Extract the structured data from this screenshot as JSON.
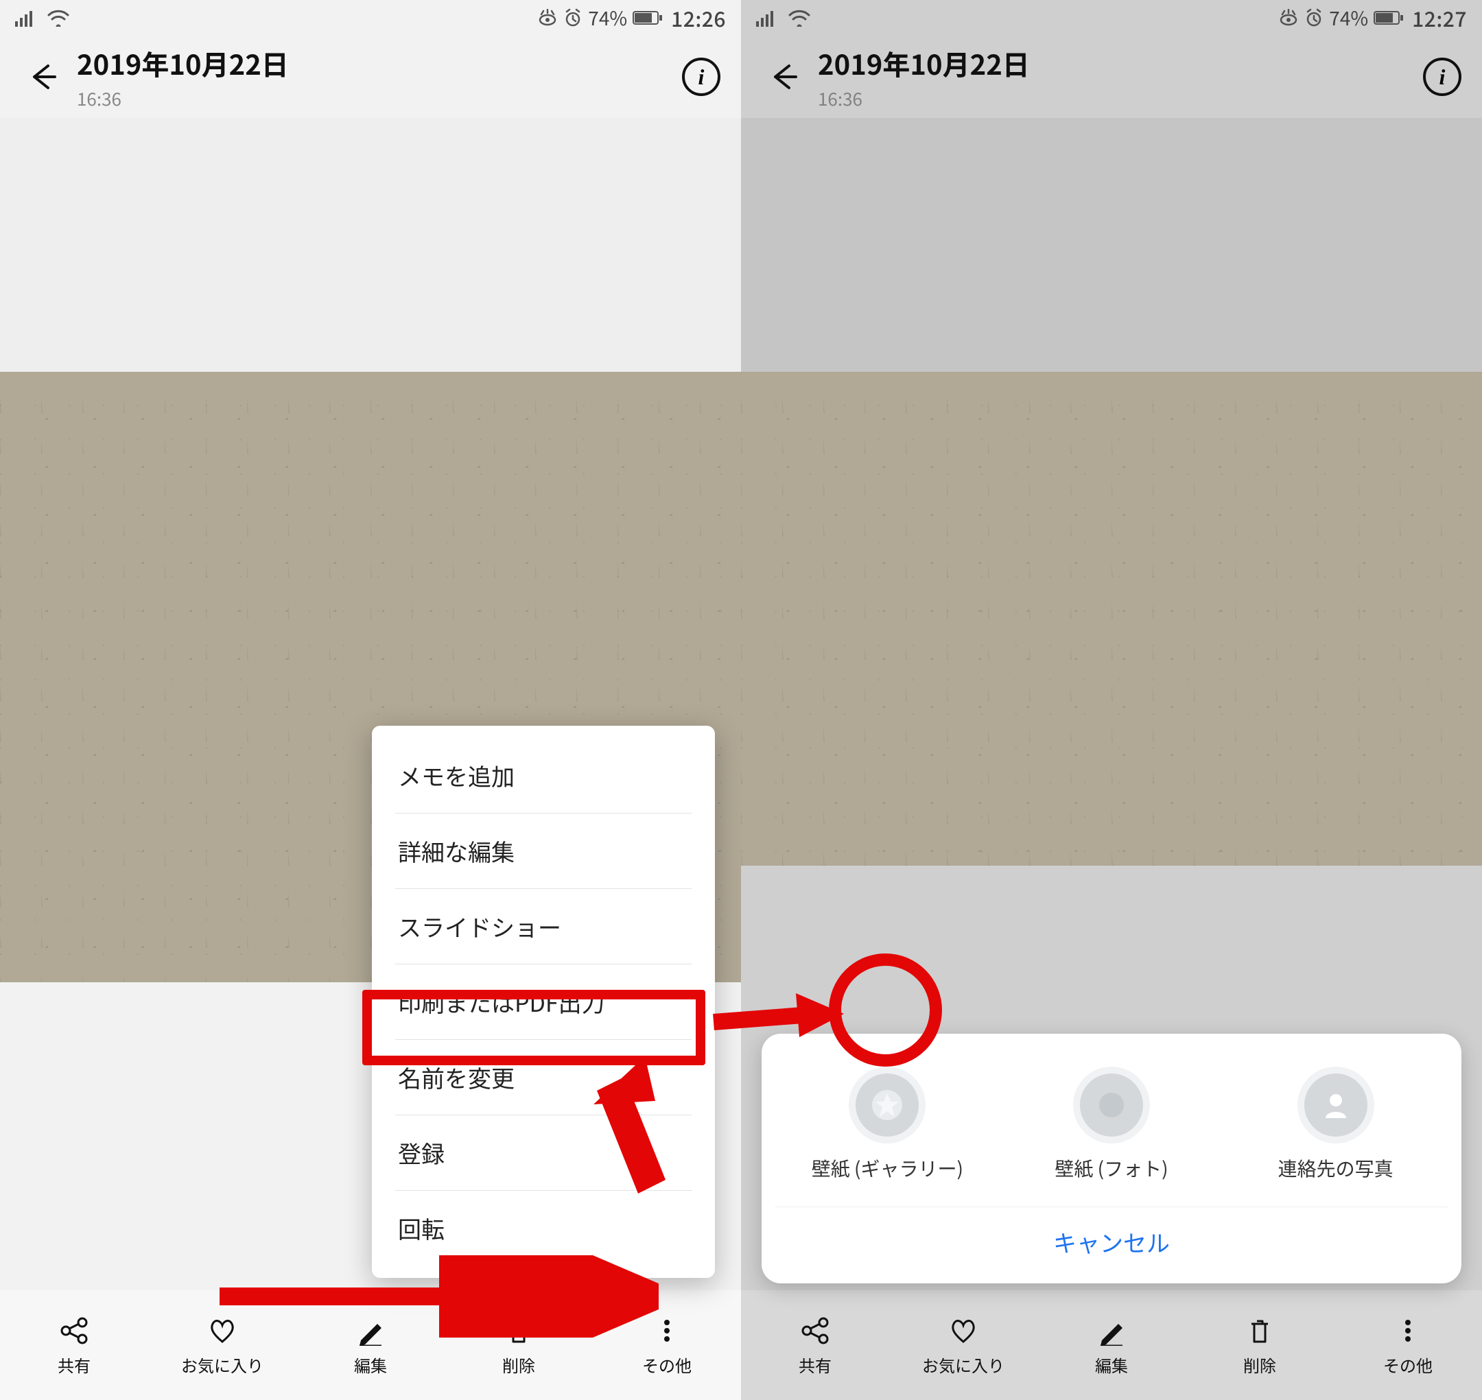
{
  "left": {
    "statusbar": {
      "battery": "74%",
      "time": "12:26"
    },
    "header": {
      "date": "2019年10月22日",
      "time": "16:36"
    },
    "menu": {
      "items": [
        {
          "label": "メモを追加"
        },
        {
          "label": "詳細な編集"
        },
        {
          "label": "スライドショー"
        },
        {
          "label": "印刷またはPDF出力"
        },
        {
          "label": "名前を変更"
        },
        {
          "label": "登録"
        },
        {
          "label": "回転"
        }
      ]
    },
    "toolbar": {
      "items": [
        {
          "label": "共有",
          "icon": "share-icon"
        },
        {
          "label": "お気に入り",
          "icon": "heart-icon"
        },
        {
          "label": "編集",
          "icon": "pencil-icon"
        },
        {
          "label": "削除",
          "icon": "trash-icon"
        },
        {
          "label": "その他",
          "icon": "more-icon"
        }
      ]
    }
  },
  "right": {
    "statusbar": {
      "battery": "74%",
      "time": "12:27"
    },
    "header": {
      "date": "2019年10月22日",
      "time": "16:36"
    },
    "sheet": {
      "options": [
        {
          "label": "壁紙 (ギャラリー)",
          "icon": "wallpaper-gallery-icon"
        },
        {
          "label": "壁紙 (フォト)",
          "icon": "wallpaper-photo-icon"
        },
        {
          "label": "連絡先の写真",
          "icon": "contact-photo-icon"
        }
      ],
      "cancel": "キャンセル"
    },
    "toolbar": {
      "items": [
        {
          "label": "共有",
          "icon": "share-icon"
        },
        {
          "label": "お気に入り",
          "icon": "heart-icon"
        },
        {
          "label": "編集",
          "icon": "pencil-icon"
        },
        {
          "label": "削除",
          "icon": "trash-icon"
        },
        {
          "label": "その他",
          "icon": "more-icon"
        }
      ]
    }
  },
  "annotations": {
    "highlight_menu_item": "登録",
    "highlight_sheet_option": "壁紙 (ギャラリー)"
  }
}
